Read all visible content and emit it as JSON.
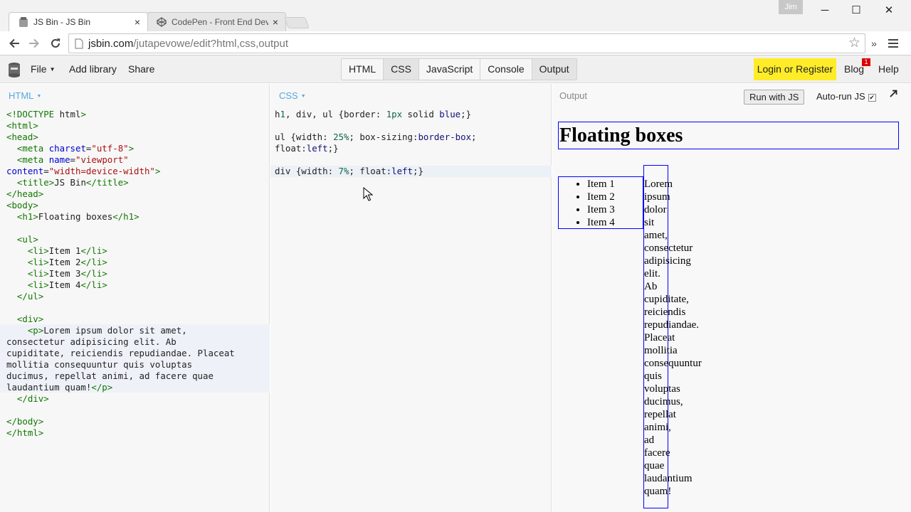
{
  "browser": {
    "tabs": [
      {
        "title": "JS Bin - JS Bin",
        "active": true
      },
      {
        "title": "CodePen - Front End Deve",
        "active": false
      }
    ],
    "user": "Jim",
    "url_host": "jsbin.com",
    "url_path": "/jutapevowe/edit?html,css,output",
    "window_controls": {
      "minimize": "─",
      "maximize": "☐",
      "close": "✕"
    }
  },
  "jsbin": {
    "menu": {
      "file": "File",
      "add_library": "Add library",
      "share": "Share"
    },
    "panels": [
      "HTML",
      "CSS",
      "JavaScript",
      "Console",
      "Output"
    ],
    "active_panels": [
      "CSS",
      "Output"
    ],
    "login": "Login or Register",
    "blog": "Blog",
    "blog_badge": "1",
    "help": "Help",
    "accent_color": "#ffec28"
  },
  "html_panel": {
    "label": "HTML",
    "lines": [
      "<!DOCTYPE html>",
      "<html>",
      "<head>",
      "  <meta charset=\"utf-8\">",
      "  <meta name=\"viewport\"",
      "content=\"width=device-width\">",
      "  <title>JS Bin</title>",
      "</head>",
      "<body>",
      "  <h1>Floating boxes</h1>",
      "",
      "  <ul>",
      "    <li>Item 1</li>",
      "    <li>Item 2</li>",
      "    <li>Item 3</li>",
      "    <li>Item 4</li>",
      "  </ul>",
      "",
      "  <div>",
      "    <p>Lorem ipsum dolor sit amet,",
      "consectetur adipisicing elit. Ab",
      "cupiditate, reiciendis repudiandae. Placeat",
      "mollitia consequuntur quis voluptas",
      "ducimus, repellat animi, ad facere quae",
      "laudantium quam!</p>",
      "  </div>",
      "",
      "</body>",
      "</html>"
    ]
  },
  "css_panel": {
    "label": "CSS",
    "lines": [
      "h1, div, ul {border: 1px solid blue;}",
      "",
      "ul {width: 25%; box-sizing:border-box;",
      "float:left;}",
      "",
      "div {width: 7%; float:left;}"
    ]
  },
  "output_panel": {
    "label": "Output",
    "run_button": "Run with JS",
    "autorun_label": "Auto-run JS",
    "autorun_checked": true,
    "heading": "Floating boxes",
    "list_items": [
      "Item 1",
      "Item 2",
      "Item 3",
      "Item 4"
    ],
    "paragraph_words": [
      "Lorem",
      "ipsum",
      "dolor",
      "sit",
      "amet,",
      "consectetur",
      "adipisicing",
      "elit.",
      "Ab",
      "cupiditate,",
      "reiciendis",
      "repudiandae.",
      "Placeat",
      "mollitia",
      "consequuntur",
      "quis",
      "voluptas",
      "ducimus,",
      "repellat",
      "animi,",
      "ad",
      "facere",
      "quae",
      "laudantium",
      "quam!"
    ]
  }
}
